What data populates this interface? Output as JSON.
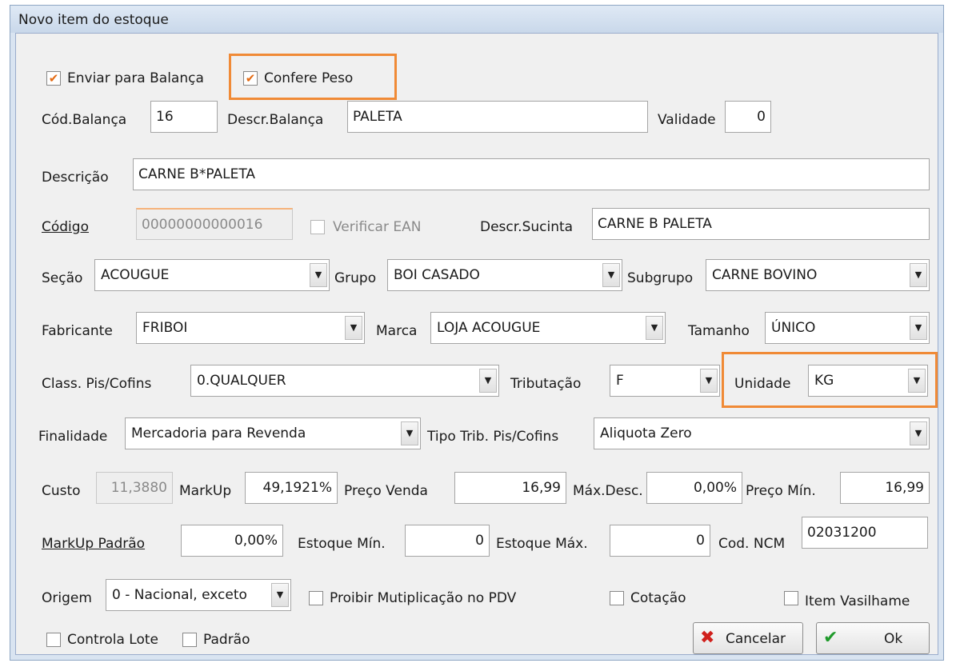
{
  "window": {
    "title": "Novo item do estoque"
  },
  "form": {
    "enviar_balanca": {
      "label": "Enviar para Balança",
      "checked": true
    },
    "confere_peso": {
      "label": "Confere Peso",
      "checked": true
    },
    "cod_balanca": {
      "label": "Cód.Balança",
      "value": "16"
    },
    "descr_balanca": {
      "label": "Descr.Balança",
      "value": "PALETA"
    },
    "validade": {
      "label": "Validade",
      "value": "0"
    },
    "descricao": {
      "label": "Descrição",
      "value": "CARNE B*PALETA"
    },
    "codigo": {
      "label": "Código",
      "value": "00000000000016"
    },
    "verificar_ean": {
      "label": "Verificar EAN",
      "checked": false
    },
    "descr_sucinta": {
      "label": "Descr.Sucinta",
      "value": "CARNE B PALETA"
    },
    "secao": {
      "label": "Seção",
      "value": "ACOUGUE"
    },
    "grupo": {
      "label": "Grupo",
      "value": "BOI CASADO"
    },
    "subgrupo": {
      "label": "Subgrupo",
      "value": "CARNE BOVINO"
    },
    "fabricante": {
      "label": "Fabricante",
      "value": "FRIBOI"
    },
    "marca": {
      "label": "Marca",
      "value": "LOJA ACOUGUE"
    },
    "tamanho": {
      "label": "Tamanho",
      "value": "ÚNICO"
    },
    "class_pis": {
      "label": "Class. Pis/Cofins",
      "value": "0.QUALQUER"
    },
    "tributacao": {
      "label": "Tributação",
      "value": "F"
    },
    "unidade": {
      "label": "Unidade",
      "value": "KG"
    },
    "finalidade": {
      "label": "Finalidade",
      "value": "Mercadoria para Revenda"
    },
    "tipo_trib": {
      "label": "Tipo Trib. Pis/Cofins",
      "value": "Aliquota Zero"
    },
    "custo": {
      "label": "Custo",
      "value": "11,3880"
    },
    "markup": {
      "label": "MarkUp",
      "value": "49,1921%"
    },
    "preco_venda": {
      "label": "Preço Venda",
      "value": "16,99"
    },
    "max_desc": {
      "label": "Máx.Desc.",
      "value": "0,00%"
    },
    "preco_min": {
      "label": "Preço Mín.",
      "value": "16,99"
    },
    "markup_padrao": {
      "label": "MarkUp Padrão",
      "value": "0,00%"
    },
    "estoque_min": {
      "label": "Estoque Mín.",
      "value": "0"
    },
    "estoque_max": {
      "label": "Estoque Máx.",
      "value": "0"
    },
    "cod_ncm": {
      "label": "Cod. NCM",
      "value": "02031200"
    },
    "origem": {
      "label": "Origem",
      "value": "0 - Nacional, exceto"
    },
    "proibir_mult": {
      "label": "Proibir Mutiplicação no PDV",
      "checked": false
    },
    "cotacao": {
      "label": "Cotação",
      "checked": false
    },
    "item_vasilhame": {
      "label": "Item Vasilhame",
      "checked": false
    },
    "controla_lote": {
      "label": "Controla Lote",
      "checked": false
    },
    "padrao": {
      "label": "Padrão",
      "checked": false
    }
  },
  "buttons": {
    "cancelar": "Cancelar",
    "ok": "Ok"
  },
  "icons": {
    "check": "✔",
    "arrow": "▼",
    "cancel": "✖",
    "ok": "✔"
  },
  "colors": {
    "highlight": "#f08a36",
    "check": "#e46a12",
    "cancel_icon": "#d0201c",
    "ok_icon": "#1f9a2a"
  }
}
